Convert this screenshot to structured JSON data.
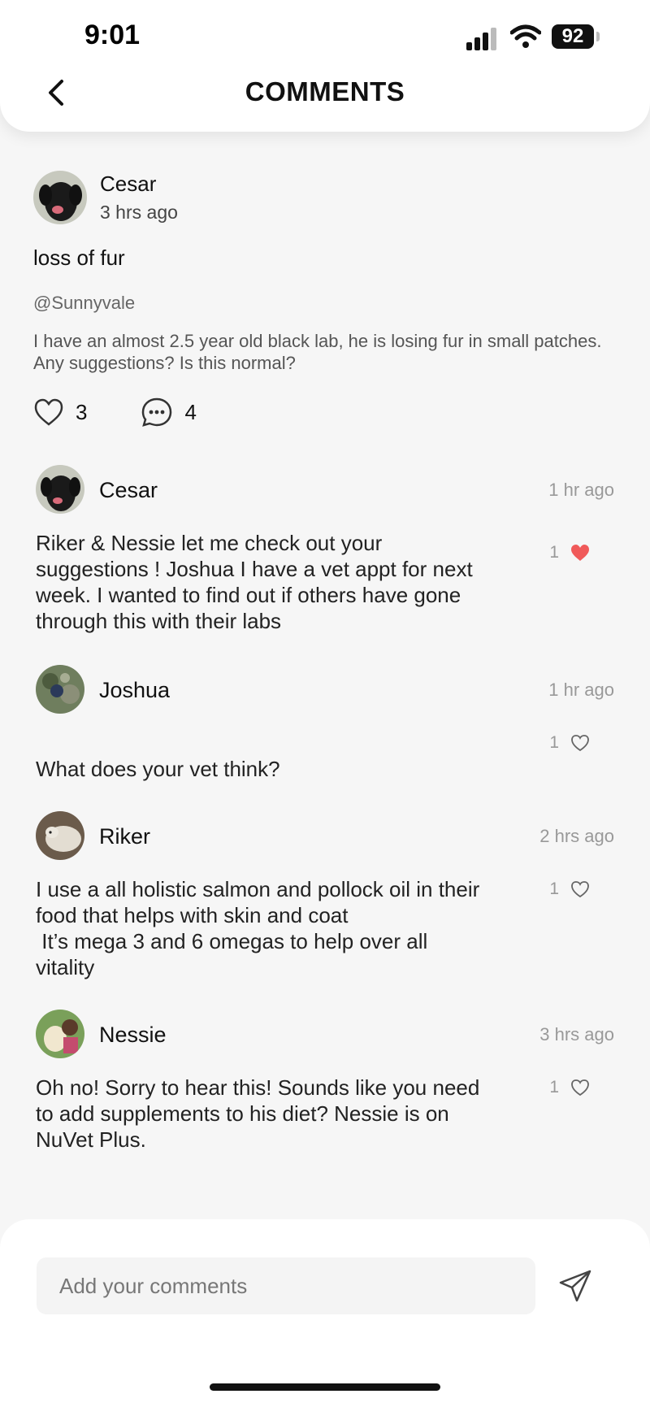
{
  "status": {
    "time": "9:01",
    "battery": "92"
  },
  "header": {
    "title": "COMMENTS"
  },
  "post": {
    "author": "Cesar",
    "time": "3 hrs ago",
    "title": "loss of fur",
    "handle": "@Sunnyvale",
    "body": "I have an almost 2.5 year old black lab, he is losing fur in small patches. Any suggestions? Is this normal?",
    "likes": "3",
    "comments": "4"
  },
  "comments": [
    {
      "name": "Cesar",
      "time": "1 hr ago",
      "text": "Riker & Nessie let me check out your suggestions ! Joshua I have a vet appt for next week. I wanted to find out if others have gone through this with their labs",
      "likes": "1",
      "liked": true
    },
    {
      "name": "Joshua",
      "time": "1 hr ago",
      "text": "What does your vet think?",
      "likes": "1",
      "liked": false
    },
    {
      "name": "Riker",
      "time": "2 hrs ago",
      "text": "I use a all holistic salmon and pollock oil in their food that helps with skin and coat\n It’s mega 3 and 6 omegas to help over all vitality",
      "likes": "1",
      "liked": false
    },
    {
      "name": "Nessie",
      "time": "3 hrs ago",
      "text": "Oh no! Sorry to hear this! Sounds like you need to add supplements to his diet? Nessie is on NuVet Plus.",
      "likes": "1",
      "liked": false
    }
  ],
  "composer": {
    "placeholder": "Add your comments"
  },
  "colors": {
    "like_active": "#f05a5a",
    "muted": "#999999"
  }
}
